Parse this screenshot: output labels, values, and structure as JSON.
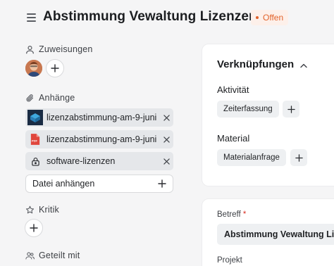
{
  "header": {
    "title": "Abstimmung Vewaltung Lizenzen",
    "status": "Offen",
    "status_color": "#e2622a"
  },
  "assignments": {
    "label": "Zuweisungen"
  },
  "attachments": {
    "label": "Anhänge",
    "items": [
      {
        "name": "lizenzabstimmung-am-9-juni",
        "icon": "image-thumbnail-icon"
      },
      {
        "name": "lizenzabstimmung-am-9-juni",
        "icon": "pdf-file-icon"
      },
      {
        "name": "software-lizenzen",
        "icon": "lock-icon"
      }
    ],
    "add_label": "Datei anhängen"
  },
  "critique": {
    "label": "Kritik"
  },
  "shared": {
    "label": "Geteilt mit"
  },
  "links": {
    "title": "Verknüpfungen",
    "activity": {
      "label": "Aktivität",
      "tag": "Zeiterfassung"
    },
    "material": {
      "label": "Material",
      "tag": "Materialanfrage"
    }
  },
  "form": {
    "subject_label": "Betreff",
    "required_mark": "*",
    "subject_value": "Abstimmung Vewaltung Lizenzen",
    "project_label": "Projekt"
  }
}
